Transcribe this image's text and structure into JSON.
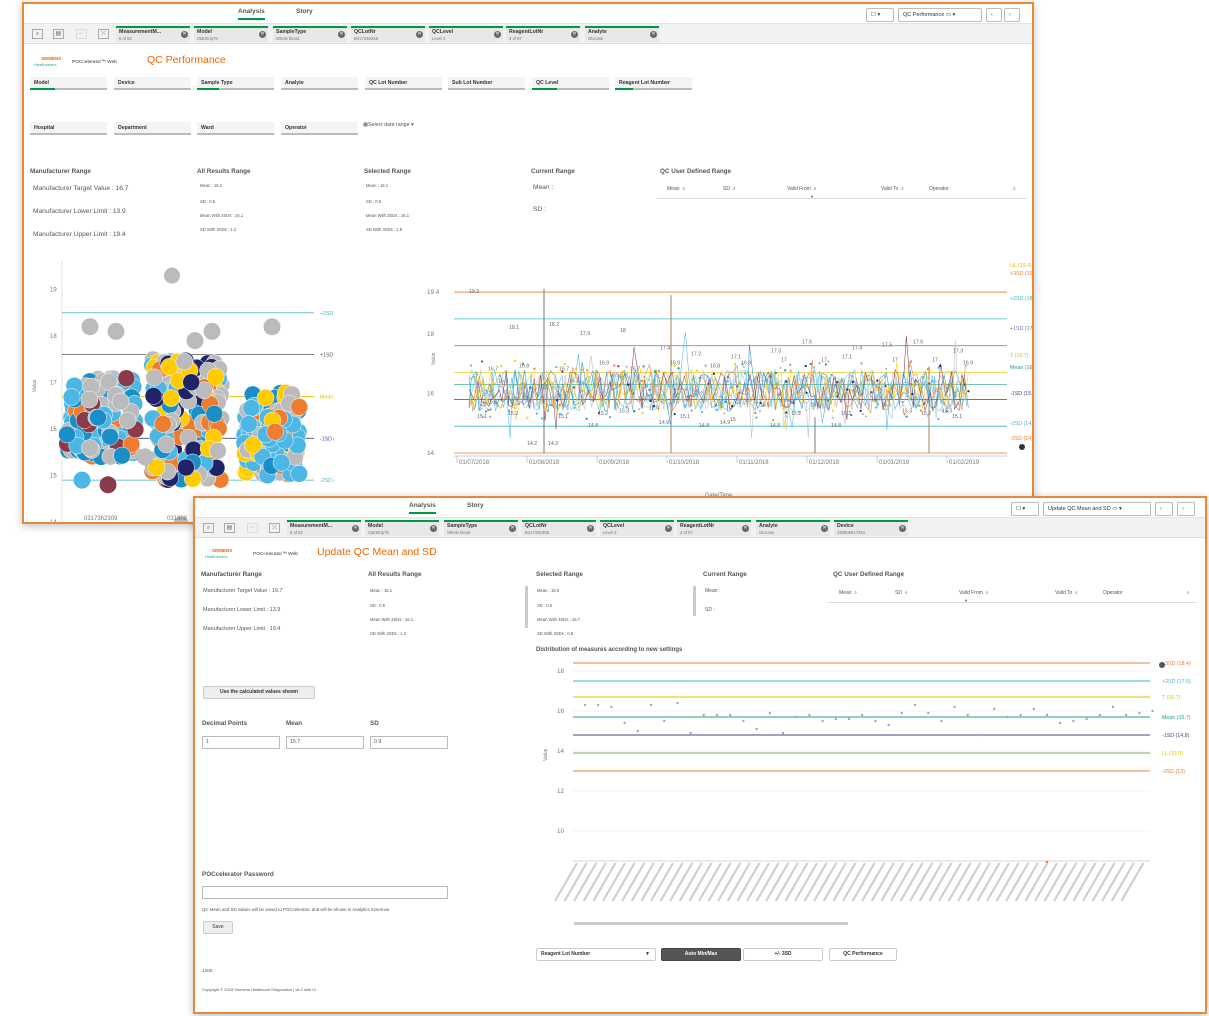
{
  "w1": {
    "tabs": [
      "Analysis",
      "Story"
    ],
    "sheet_label": "QC Performance",
    "chips": [
      {
        "title": "MeasurementM...",
        "sub": "8 of 82"
      },
      {
        "title": "Model",
        "sub": "StatStrip78"
      },
      {
        "title": "SampleType",
        "sub": "Whole blood"
      },
      {
        "title": "QCLotNr",
        "sub": "B4173463S5"
      },
      {
        "title": "QCLevel",
        "sub": "Level 3"
      },
      {
        "title": "ReagentLotNr",
        "sub": "3 of 87"
      },
      {
        "title": "Analyte",
        "sub": "Glucose"
      }
    ],
    "brand": "SIEMENS",
    "brand_sub": "Healthineers",
    "product": "POCcelerator™ Web",
    "page_title": "QC Performance",
    "filters_row1": [
      "Model",
      "Device",
      "Sample Type",
      "Analyte",
      "QC Lot Number",
      "Sub Lot Number",
      "QC Level",
      "Reagent Lot Number"
    ],
    "filters_row2": [
      "Hospital",
      "Department",
      "Ward",
      "Operator"
    ],
    "date_range": "Select date range",
    "manufacturer": {
      "title": "Manufacturer Range",
      "target": "Manufacturer Target Value : 16.7",
      "lower": "Manufacturer Lower Limit : 13.9",
      "upper": "Manufacturer Upper Limit : 19.4"
    },
    "all_results": {
      "title": "All Results Range",
      "mean": "Mean : 16.2",
      "sd": "SD : 0.6",
      "mean2": "Mean With 3SDs : 16.1",
      "sd2": "SD With 3SDs : 1.2"
    },
    "selected": {
      "title": "Selected Range",
      "mean": "Mean : 16.1",
      "sd": "SD : 0.5",
      "mean2": "Mean With 3SDs : 16.1",
      "sd2": "SD With 3SDs : 1.8"
    },
    "current": {
      "title": "Current Range",
      "mean": "Mean :",
      "sd": "SD :"
    },
    "userdef": {
      "title": "QC User Defined Range",
      "cols": [
        "Mean",
        "SD",
        "Valid From",
        "Valid To",
        "Operator"
      ]
    },
    "scatter": {
      "y_ticks": [
        "19",
        "18",
        "17",
        "16",
        "15",
        "14"
      ],
      "y_label": "Value",
      "x_ticks": [
        "0317362309",
        "031808"
      ],
      "lines": [
        "+2SD (18.5)",
        "+1SD (17.6)",
        "Mean (16.7)",
        "-1SD (15.8)",
        "-2SD (14.9)"
      ]
    },
    "ljchart": {
      "y_ticks": [
        "19.4",
        "18",
        "16",
        "14"
      ],
      "y_label": "Value",
      "x_label": "Date/Time,",
      "x_ticks": [
        "01/07/2018",
        "01/08/2018",
        "01/09/2018",
        "01/10/2018",
        "01/11/2018",
        "01/12/2018",
        "01/01/2019",
        "01/02/2019"
      ],
      "lines": [
        "UL (19.4)",
        "+3SD (19.4)",
        "+2SD (18.5)",
        "+1SD (17.6)",
        "T (16.7)",
        "Mean (16.7)",
        "-1SD (15.8)",
        "-2SD (14.9)",
        "-3SD (14)"
      ],
      "labels": [
        "19.3",
        "18.1",
        "18.2",
        "17.9",
        "18",
        "17.4",
        "17.2",
        "17.1",
        "17.3",
        "17.6",
        "17.1",
        "17.5",
        "17.6",
        "17.3",
        "16.7",
        "16.8",
        "16.7",
        "16.9",
        "16.7",
        "16.9",
        "16.8",
        "16.9",
        "17",
        "17",
        "17.4",
        "17",
        "17",
        "16.9",
        "16.3",
        "16.1",
        "16.3",
        "16.5",
        "15.4",
        "15.1",
        "14.9",
        "15.5",
        "15.2",
        "14.8",
        "15.7",
        "15.3",
        "15.3",
        "15.1",
        "15.2",
        "14.2",
        "14.8",
        "15.3",
        "14.9",
        "14.8",
        "15",
        "14.8",
        "15.5",
        "15.2",
        "15.5",
        "15.2",
        "15.1",
        "15.6",
        "14.2",
        "15.1",
        "15.2",
        "15.7",
        "15.6"
      ]
    }
  },
  "w2": {
    "tabs": [
      "Analysis",
      "Story"
    ],
    "sheet_label": "Update QC Mean and SD",
    "chips": [
      {
        "title": "MeasurementM...",
        "sub": "8 of 82"
      },
      {
        "title": "Model",
        "sub": "StatStrip78"
      },
      {
        "title": "SampleType",
        "sub": "Whole blood"
      },
      {
        "title": "QCLotNr",
        "sub": "B4173463S5"
      },
      {
        "title": "QCLevel",
        "sub": "Level 3"
      },
      {
        "title": "ReagentLotNr",
        "sub": "3 of 87"
      },
      {
        "title": "Analyte",
        "sub": "Glucose"
      },
      {
        "title": "Device",
        "sub": "190806617334"
      }
    ],
    "brand": "SIEMENS",
    "brand_sub": "Healthineers",
    "product": "POCcelerator™ Web",
    "page_title": "Update QC Mean and SD",
    "manufacturer": {
      "title": "Manufacturer Range",
      "target": "Manufacturer Target Value : 16.7",
      "lower": "Manufacturer Lower Limit : 13.9",
      "upper": "Manufacturer Upper Limit : 19.4"
    },
    "all_results": {
      "title": "All Results Range",
      "mean": "Mean : 16.1",
      "sd": "SD : 0.5",
      "mean2": "Mean With 3SDs : 16.1",
      "sd2": "SD With 3SDs : 1.2"
    },
    "selected": {
      "title": "Selected Range",
      "mean": "Mean : 15.8",
      "sd": "SD : 0.5",
      "mean2": "Mean With 3SDs : 15.7",
      "sd2": "SD With 3SDs : 0.8"
    },
    "current": {
      "title": "Current Range",
      "mean": "Mean :",
      "sd": "SD :"
    },
    "userdef": {
      "title": "QC User Defined Range",
      "cols": [
        "Mean",
        "SD",
        "Valid From",
        "Valid To",
        "Operator"
      ]
    },
    "use_calc_btn": "Use the calculated values shown",
    "decimal_label": "Decimal Points",
    "mean_label": "Mean",
    "sd_label": "SD",
    "decimal_value": "1",
    "mean_value": "15.7",
    "sd_value": "0.9",
    "password_label": "POCcelerator Password",
    "note": "QC Mean and SD values will be saved to POCcelerator, and will be shown in Analytics tomorrow",
    "save_btn": "Save",
    "counter": "1000",
    "copyright": "Copyright © 2018 Siemens Healthcare Diagnostics | v6.1 with CI",
    "dist": {
      "title": "Distribution of measures according to new settings",
      "y_ticks": [
        "18",
        "16",
        "14",
        "12",
        "10"
      ],
      "y_label": "Value",
      "lines": [
        "+3SD (18.4)",
        "+2SD (17.5)",
        "T (16.7)",
        "Mean (15.7)",
        "-1SD (14.8)",
        "LL (13.9)",
        "-3SD (13)"
      ]
    },
    "controls": {
      "dropdown": "Reagent Lot Number",
      "auto": "Auto Min/Max",
      "pm3sd": "+/- 3SD",
      "qcperf": "QC Performance"
    }
  }
}
